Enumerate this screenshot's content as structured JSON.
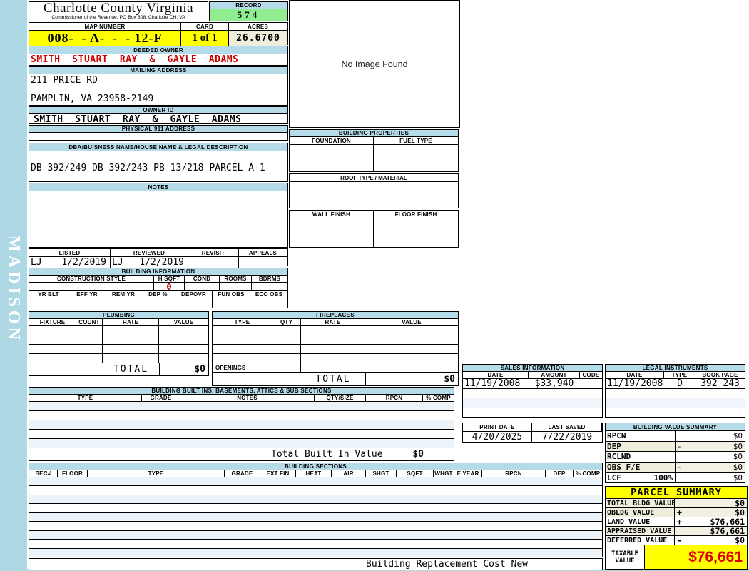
{
  "sidebar": {
    "watermark": "MADISON"
  },
  "county": {
    "title": "Charlotte County Virginia",
    "subtitle": "Commissioner of the Revenue, PO Box 308, Charlotte CH, VA"
  },
  "record": {
    "label": "RECORD",
    "value": "574"
  },
  "map": {
    "label": "MAP NUMBER",
    "value": "008-  - A-  -  - 12-F"
  },
  "card": {
    "label": "CARD",
    "value": "1 of 1"
  },
  "acres": {
    "label": "ACRES",
    "value": "26.6700"
  },
  "deeded_owner": {
    "label": "DEEDED OWNER",
    "value": "SMITH  STUART  RAY  &  GAYLE  ADAMS"
  },
  "mailing": {
    "label": "MAILING ADDRESS",
    "line1": "211 PRICE RD",
    "line2": "PAMPLIN, VA 23958-2149"
  },
  "owner_id": {
    "label": "OWNER ID",
    "value": "SMITH  STUART  RAY  &  GAYLE  ADAMS"
  },
  "physical": {
    "label": "PHYSICAL 911 ADDRESS",
    "value": ""
  },
  "dba": {
    "label": "DBA/BUISNESS NAME/HOUSE NAME & LEGAL DESCRIPTION",
    "value": "DB 392/249 DB 392/243 PB 13/218 PARCEL A-1"
  },
  "notes": {
    "label": "NOTES",
    "value": ""
  },
  "review": {
    "columns": [
      "LISTED",
      "REVIEWED",
      "REVISIT",
      "APPEALS"
    ],
    "listed_by": "LJ",
    "listed_date": "1/2/2019",
    "reviewed_by": "LJ",
    "reviewed_date": "1/2/2019",
    "revisit": "",
    "appeals": ""
  },
  "binfo": {
    "title": "BUILDING INFORMATION",
    "r1": [
      "CONSTRUCTION STYLE",
      "H SQFT",
      "COND",
      "ROOMS",
      "BDRMS"
    ],
    "h_sqft": "0",
    "r2": [
      "YR BLT",
      "EFF YR",
      "REM YR",
      "DEP %",
      "DEPOVR",
      "FUN OBS",
      "ECO OBS"
    ]
  },
  "image_panel": {
    "text": "No Image Found"
  },
  "bprops": {
    "title": "BUILDING PROPERTIES",
    "foundation": "FOUNDATION",
    "fuel": "FUEL TYPE",
    "roof": "ROOF TYPE / MATERIAL",
    "wall": "WALL FINISH",
    "floor": "FLOOR FINISH"
  },
  "plumbing": {
    "title": "PLUMBING",
    "cols": [
      "FIXTURE",
      "COUNT",
      "RATE",
      "VALUE"
    ],
    "total_label": "TOTAL",
    "total_value": "$0"
  },
  "fireplaces": {
    "title": "FIREPLACES",
    "cols": [
      "TYPE",
      "QTY",
      "RATE",
      "VALUE"
    ],
    "openings_label": "OPENINGS",
    "total_label": "TOTAL",
    "total_value": "$0"
  },
  "built_ins": {
    "title": "BUILDING BUILT INS, BASEMENTS, ATTICS & SUB SECTIONS",
    "cols": [
      "TYPE",
      "GRADE",
      "NOTES",
      "QTY/SIZE",
      "RPCN",
      "% COMP"
    ],
    "total_label": "Total Built In Value",
    "total_value": "$0"
  },
  "sections": {
    "title": "BUILDING SECTIONS",
    "cols": [
      "SEC#",
      "FLOOR",
      "TYPE",
      "GRADE",
      "EXT FIN",
      "HEAT",
      "AIR",
      "SHGT",
      "SQFT",
      "WHGT",
      "E YEAR",
      "RPCN",
      "DEP",
      "% COMP"
    ]
  },
  "sales": {
    "title": "SALES INFORMATION",
    "cols": [
      "DATE",
      "AMOUNT",
      "CODE"
    ],
    "row": {
      "date": "11/19/2008",
      "amount": "$33,940",
      "code": ""
    }
  },
  "legal": {
    "title": "LEGAL INSTRUMENTS",
    "cols": [
      "DATE",
      "TYPE",
      "BOOK PAGE"
    ],
    "row": {
      "date": "11/19/2008",
      "type": "D",
      "book_page": "392 243"
    }
  },
  "dates": {
    "print_label": "PRINT DATE",
    "print_value": "4/20/2025",
    "saved_label": "LAST SAVED",
    "saved_value": "7/22/2019"
  },
  "bvs": {
    "title": "BUILDING VALUE SUMMARY",
    "rows": [
      {
        "label": "RPCN",
        "pct": "",
        "op": "",
        "value": "$0"
      },
      {
        "label": "DEP",
        "pct": "",
        "op": "-",
        "value": "$0"
      },
      {
        "label": "RCLND",
        "pct": "",
        "op": "",
        "value": "$0"
      },
      {
        "label": "OBS F/E",
        "pct": "",
        "op": "-",
        "value": "$0"
      },
      {
        "label": "LCF",
        "pct": "100%",
        "op": "",
        "value": "$0"
      }
    ]
  },
  "parcel": {
    "title": "PARCEL SUMMARY",
    "rows": [
      {
        "label": "TOTAL BLDG VALUE",
        "op": "",
        "value": "$0"
      },
      {
        "label": "OBLDG VALUE",
        "op": "+",
        "value": "$0"
      },
      {
        "label": "LAND VALUE",
        "op": "+",
        "value": "$76,661"
      },
      {
        "label": "APPRAISED VALUE",
        "op": "",
        "value": "$76,661"
      },
      {
        "label": "DEFERRED VALUE",
        "op": "-",
        "value": "$0"
      }
    ],
    "taxable_label": "TAXABLE VALUE",
    "taxable_value": "$76,661"
  },
  "footer": {
    "text": "Building Replacement Cost New"
  }
}
